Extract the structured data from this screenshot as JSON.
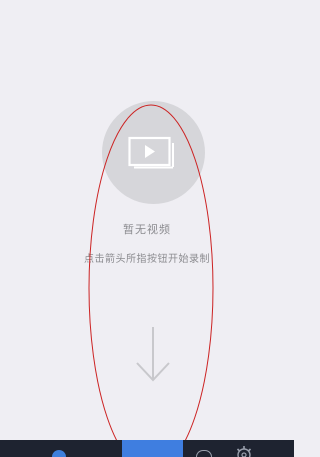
{
  "empty_state": {
    "icon": "video-play-icon",
    "title": "暂无视频",
    "hint": "点击箭头所指按钮开始录制",
    "arrow_icon": "arrow-down-icon"
  },
  "bottom_nav": {
    "items": [
      {
        "icon": "profile-icon"
      },
      {
        "icon": "record-icon"
      },
      {
        "icon": "cloud-icon"
      },
      {
        "icon": "gear-icon"
      }
    ]
  },
  "colors": {
    "background": "#efeef3",
    "circle": "#d6d6da",
    "nav_bar": "#1e2330",
    "accent": "#3f7ee0",
    "annotation": "#cc2222"
  }
}
